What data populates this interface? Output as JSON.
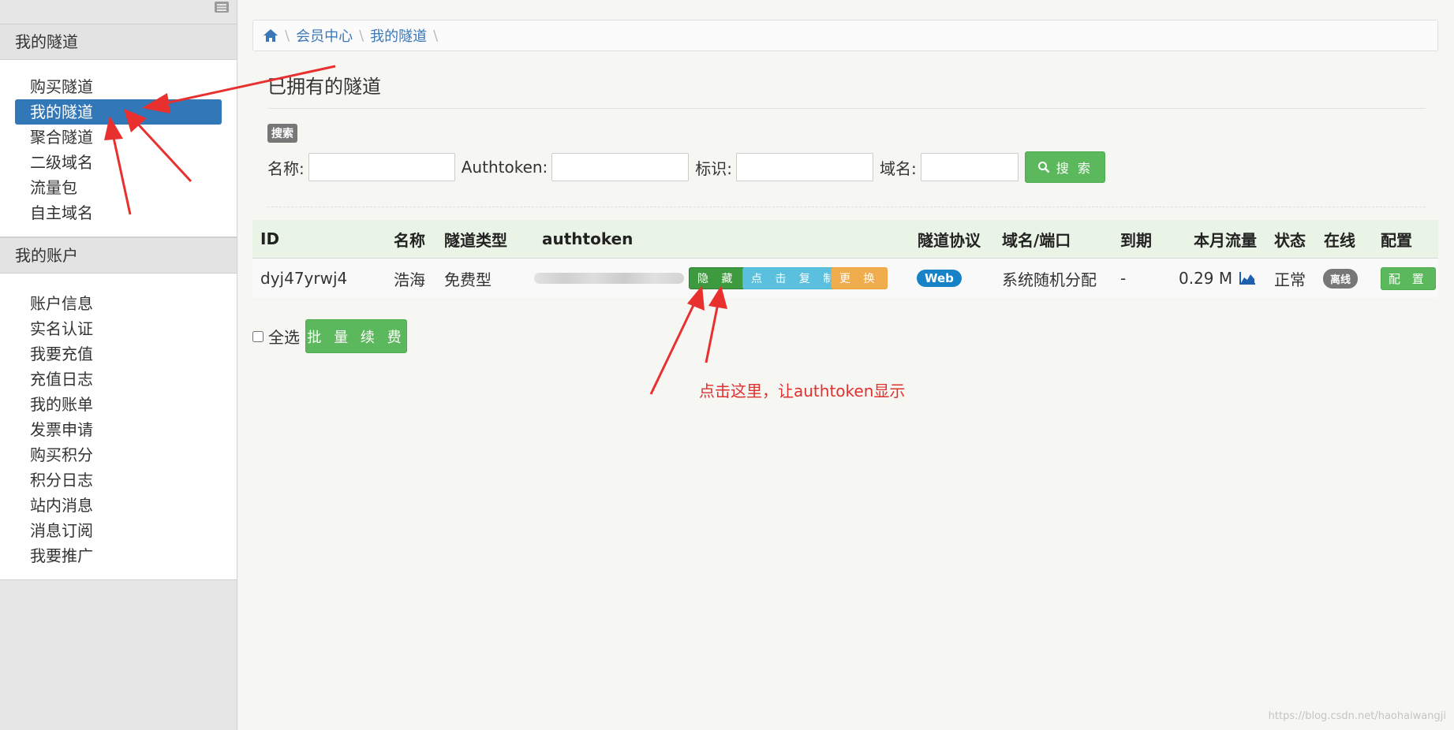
{
  "sidebar": {
    "section_tunnels": "我的隧道",
    "tunnel_items": [
      "购买隧道",
      "我的隧道",
      "聚合隧道",
      "二级域名",
      "流量包",
      "自主域名"
    ],
    "section_account": "我的账户",
    "account_items": [
      "账户信息",
      "实名认证",
      "我要充值",
      "充值日志",
      "我的账单",
      "发票申请",
      "购买积分",
      "积分日志",
      "站内消息",
      "消息订阅",
      "我要推广"
    ]
  },
  "breadcrumb": [
    "会员中心",
    "我的隧道"
  ],
  "page_title": "已拥有的隧道",
  "search": {
    "badge": "搜索",
    "name_label": "名称:",
    "authtoken_label": "Authtoken:",
    "tag_label": "标识:",
    "domain_label": "域名:",
    "button": "搜 索"
  },
  "table": {
    "headers": {
      "id": "ID",
      "name": "名称",
      "type": "隧道类型",
      "authtoken": "authtoken",
      "protocol": "隧道协议",
      "domain": "域名/端口",
      "expire": "到期",
      "traffic": "本月流量",
      "status": "状态",
      "online": "在线",
      "config": "配置"
    },
    "row": {
      "id": "dyj47yrwj4",
      "name": "浩海",
      "type": "免费型",
      "btn_hide": "隐 藏",
      "btn_copy": "点 击 复 制",
      "btn_swap": "更 换",
      "protocol": "Web",
      "domain": "系统随机分配",
      "expire": "-",
      "traffic": "0.29 M",
      "status": "正常",
      "online": "离线",
      "config": "配 置"
    }
  },
  "select_all": "全选",
  "batch_renew": "批 量 续 费",
  "annotation": "点击这里，让authtoken显示",
  "watermark": "https://blog.csdn.net/haohaiwangji",
  "colors": {
    "active": "#3278b8",
    "success": "#5cb85c",
    "info": "#5bc0de",
    "warning": "#f0ad4e",
    "annotation": "#e0312f"
  }
}
